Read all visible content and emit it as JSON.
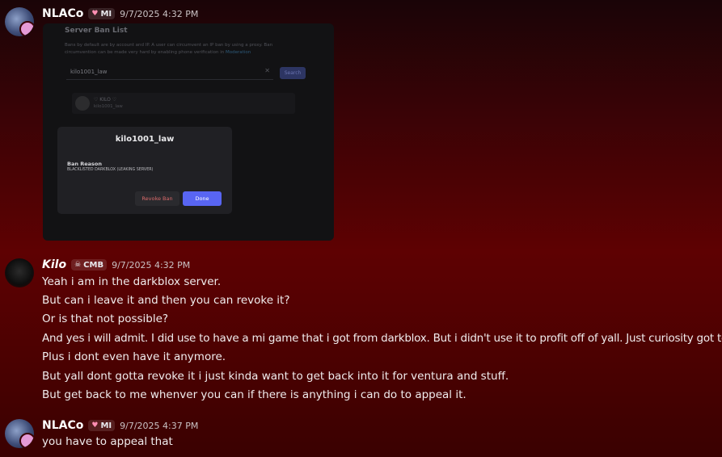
{
  "messages": [
    {
      "author": "NLACo",
      "role_tag": "MI",
      "role_icon": "heart-icon",
      "timestamp": "9/7/2025 4:32 PM",
      "attachment": {
        "title": "Server Ban List",
        "description": "Bans by default are by account and IP. A user can circumvent an IP ban by using a proxy. Ban circumvention can be made very hard by enabling phone verification in",
        "description_link": "Moderation",
        "search_value": "kilo1001_law",
        "search_button": "Search",
        "result_name": "♡ KILO ♡",
        "result_username": "kilo1001_law",
        "modal": {
          "title": "kilo1001_law",
          "ban_reason_label": "Ban Reason",
          "ban_reason": "BLACKLISTED DARKBLOX (LEAKING SERVER)",
          "revoke_button": "Revoke Ban",
          "done_button": "Done"
        }
      }
    },
    {
      "author": "Kilo",
      "role_tag": "CMB",
      "role_icon": "skull-icon",
      "timestamp": "9/7/2025 4:32 PM",
      "lines": [
        "Yeah i am in the darkblox server.",
        "But can i leave it and then you can revoke it?",
        "Or is that not possible?",
        "And yes i will admit. I did use to have a mi game that i got from darkblox. But i didn't use it to profit off of yall. Just curiosity got to me.",
        "Plus i dont even have it anymore.",
        "But yall dont gotta revoke it i just kinda want to get back into it for ventura and stuff.",
        "But get back to me whenver you can if there is anything i can do to appeal it."
      ]
    },
    {
      "author": "NLACo",
      "role_tag": "MI",
      "role_icon": "heart-icon",
      "timestamp": "9/7/2025 4:37 PM",
      "lines": [
        "you have to appeal that"
      ]
    }
  ],
  "colors": {
    "accent": "#5865f2",
    "danger": "#d96a6a",
    "background_top": "#1a0407",
    "background_mid": "#5e0102"
  }
}
